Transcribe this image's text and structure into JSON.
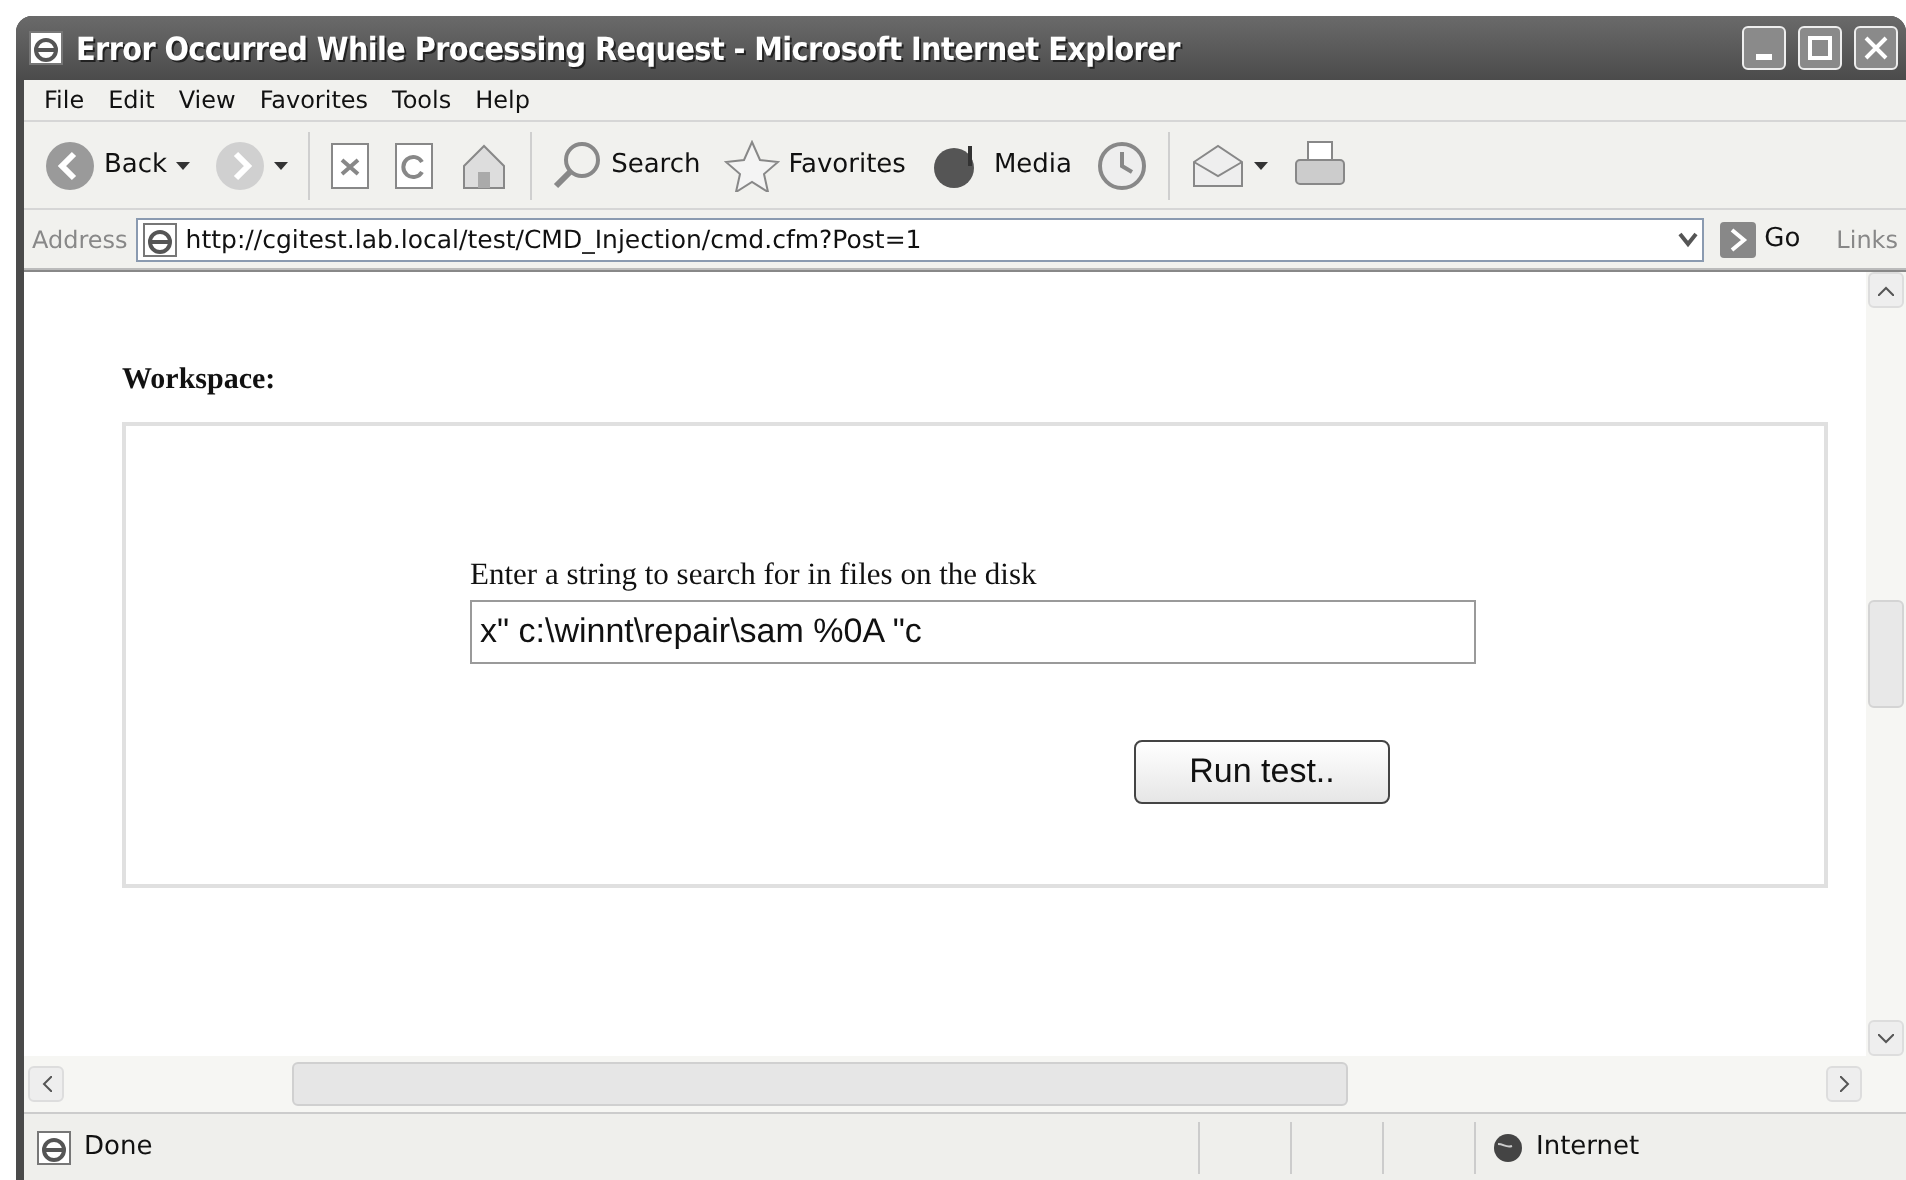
{
  "window": {
    "title": "Error Occurred While Processing Request - Microsoft Internet Explorer"
  },
  "menu": [
    "File",
    "Edit",
    "View",
    "Favorites",
    "Tools",
    "Help"
  ],
  "toolbar": [
    {
      "kind": "back",
      "label": "Back"
    },
    {
      "kind": "forward"
    },
    {
      "kind": "stop"
    },
    {
      "kind": "refresh"
    },
    {
      "kind": "home"
    },
    {
      "kind": "search",
      "label": "Search"
    },
    {
      "kind": "favorites",
      "label": "Favorites"
    },
    {
      "kind": "media",
      "label": "Media"
    },
    {
      "kind": "history"
    },
    {
      "kind": "mail"
    },
    {
      "kind": "print"
    }
  ],
  "address": {
    "label": "Address",
    "value": "http://cgitest.lab.local/test/CMD_Injection/cmd.cfm?Post=1",
    "go": "Go",
    "links": "Links"
  },
  "page": {
    "heading": "Workspace:",
    "prompt": "Enter a string to search for in files on the disk",
    "value": "x\" c:\\winnt\\repair\\sam %0A \"c",
    "button": "Run test.."
  },
  "status_bar": {
    "text": "Done",
    "zone": "Internet"
  }
}
